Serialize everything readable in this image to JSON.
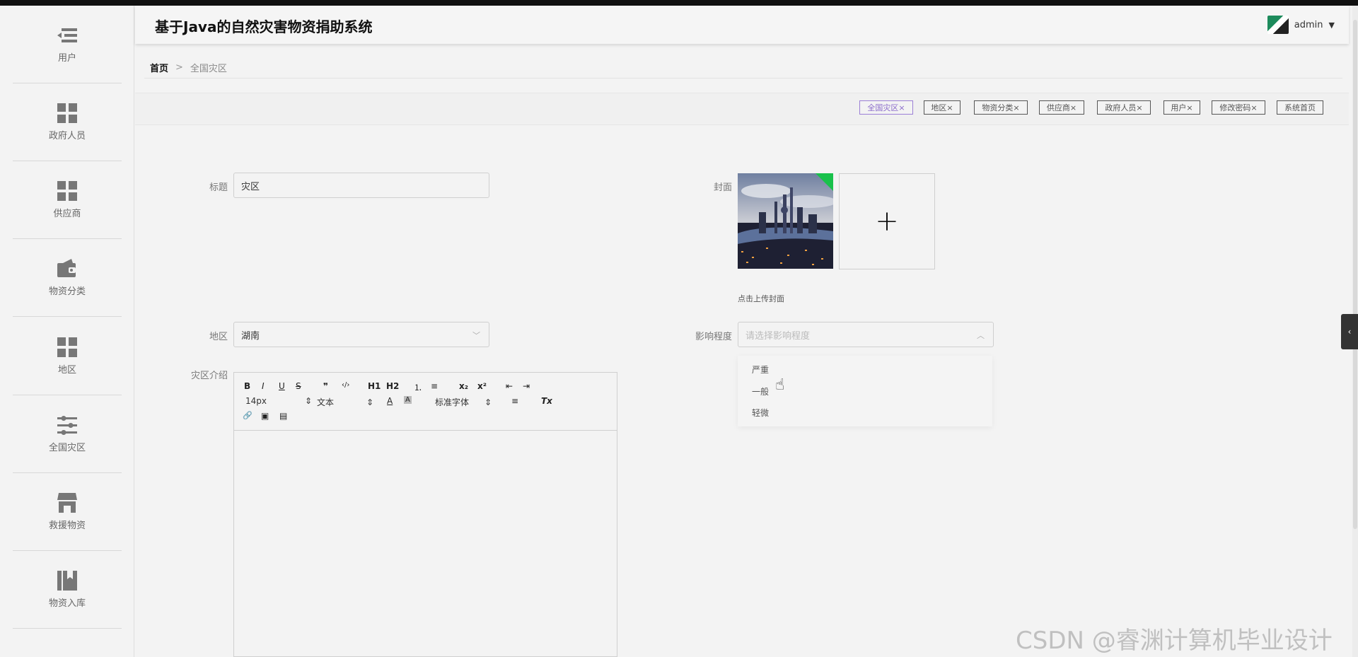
{
  "app": {
    "title": "基于Java的自然灾害物资捐助系统",
    "user": "admin"
  },
  "sidebar": {
    "items": [
      {
        "label": "用户",
        "icon": "user-list-icon"
      },
      {
        "label": "政府人员",
        "icon": "grid-icon"
      },
      {
        "label": "供应商",
        "icon": "grid-icon"
      },
      {
        "label": "物资分类",
        "icon": "wallet-icon"
      },
      {
        "label": "地区",
        "icon": "grid-icon"
      },
      {
        "label": "全国灾区",
        "icon": "sliders-icon"
      },
      {
        "label": "救援物资",
        "icon": "store-icon"
      },
      {
        "label": "物资入库",
        "icon": "book-icon"
      }
    ]
  },
  "breadcrumb": {
    "home": "首页",
    "separator": ">",
    "current": "全国灾区"
  },
  "tags": [
    {
      "label": "全国灾区",
      "close": "×",
      "active": true
    },
    {
      "label": "地区",
      "close": "×"
    },
    {
      "label": "物资分类",
      "close": "×"
    },
    {
      "label": "供应商",
      "close": "×"
    },
    {
      "label": "政府人员",
      "close": "×"
    },
    {
      "label": "用户",
      "close": "×"
    },
    {
      "label": "修改密码",
      "close": "×"
    },
    {
      "label": "系统首页",
      "close": ""
    }
  ],
  "form": {
    "title_label": "标题",
    "title_value": "灾区",
    "cover_label": "封面",
    "cover_hint": "点击上传封面",
    "cover_plus": "+",
    "region_label": "地区",
    "region_value": "湖南",
    "impact_label": "影响程度",
    "impact_placeholder": "请选择影响程度",
    "intro_label": "灾区介绍"
  },
  "impact_options": [
    "严重",
    "一般",
    "轻微"
  ],
  "editor": {
    "font_size": "14px",
    "heading": "文本",
    "font_family": "标准字体",
    "buttons": [
      "B",
      "I",
      "U",
      "S",
      "❞",
      "‹/›",
      "H1",
      "H2",
      "⒈",
      "≡",
      "x₂",
      "x²",
      "⇤",
      "⇥",
      "A",
      "A",
      "≡",
      "Tx",
      "🔗",
      "▣",
      "▤"
    ]
  },
  "watermark": "CSDN @睿渊计算机毕业设计",
  "colors": {
    "active_tag": "#8a6acb",
    "accent_corner": "#19c14b"
  }
}
